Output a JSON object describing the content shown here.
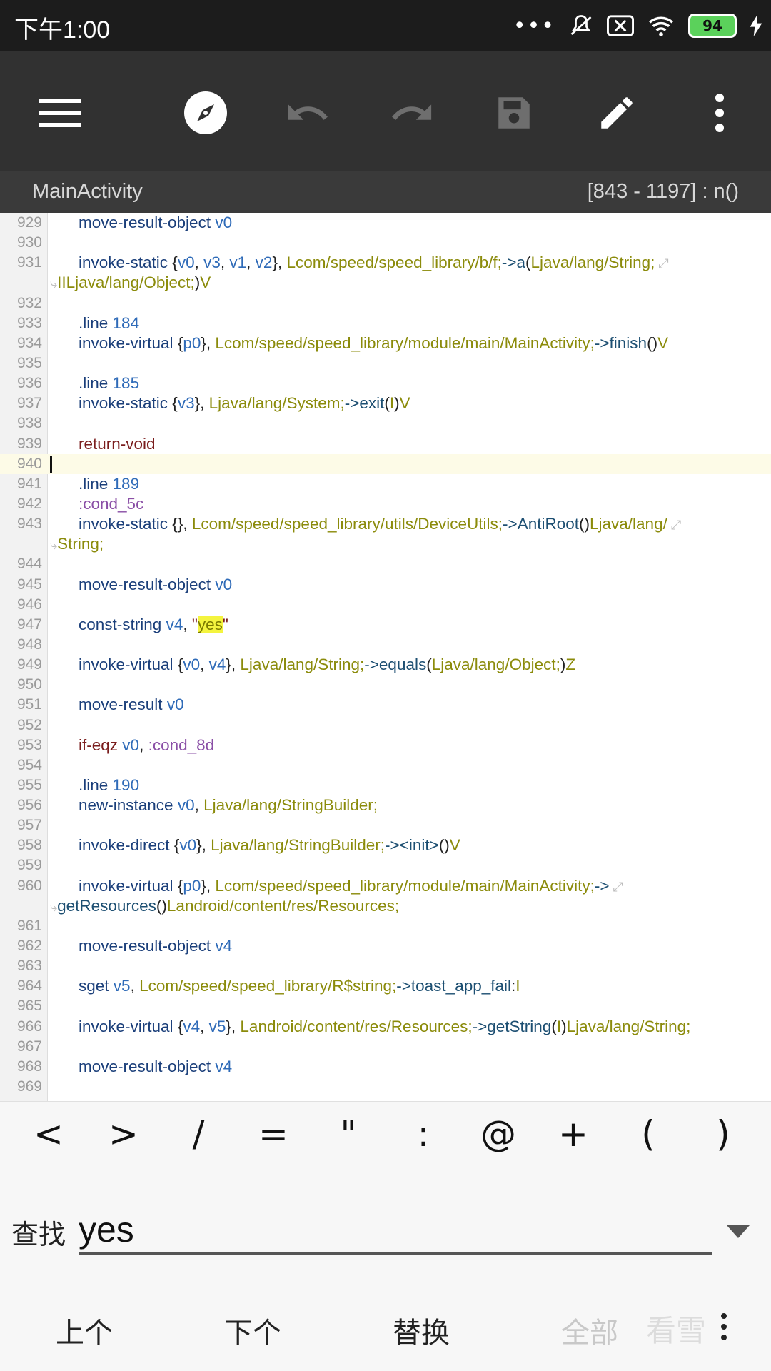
{
  "status": {
    "time": "下午1:00",
    "battery": "94"
  },
  "toolbar": {
    "icons": [
      "menu-icon",
      "compass-icon",
      "undo-icon",
      "redo-icon",
      "save-icon",
      "edit-icon",
      "more-icon"
    ]
  },
  "header": {
    "title": "MainActivity",
    "range": "[843 - 1197] : n()"
  },
  "editor": {
    "current_line": "940",
    "lines": [
      {
        "n": "929",
        "segs": [
          [
            "move-result-object",
            "kw"
          ],
          [
            " ",
            "pun"
          ],
          [
            "v0",
            "reg"
          ]
        ]
      },
      {
        "n": "930",
        "segs": []
      },
      {
        "n": "931",
        "segs": [
          [
            "invoke-static",
            "kw"
          ],
          [
            " {",
            "pun"
          ],
          [
            "v0",
            "reg"
          ],
          [
            ", ",
            "pun"
          ],
          [
            "v3",
            "reg"
          ],
          [
            ", ",
            "pun"
          ],
          [
            "v1",
            "reg"
          ],
          [
            ", ",
            "pun"
          ],
          [
            "v2",
            "reg"
          ],
          [
            "}, ",
            "pun"
          ],
          [
            "Lcom/speed/speed_library/b/f;",
            "ty"
          ],
          [
            "->",
            "cls"
          ],
          [
            "a",
            "cls"
          ],
          [
            "(",
            "pun"
          ],
          [
            "Ljava/lang/String;",
            "ty"
          ]
        ],
        "wrap": true
      },
      {
        "n": "",
        "cont": true,
        "segs": [
          [
            "IILjava/lang/Object;",
            "ty"
          ],
          [
            ")",
            "pun"
          ],
          [
            "V",
            "ty"
          ]
        ]
      },
      {
        "n": "932",
        "segs": []
      },
      {
        "n": "933",
        "segs": [
          [
            ".line",
            "kw"
          ],
          [
            " ",
            "pun"
          ],
          [
            "184",
            "reg"
          ]
        ]
      },
      {
        "n": "934",
        "segs": [
          [
            "invoke-virtual",
            "kw"
          ],
          [
            " {",
            "pun"
          ],
          [
            "p0",
            "reg"
          ],
          [
            "}, ",
            "pun"
          ],
          [
            "Lcom/speed/speed_library/module/main/MainActivity;",
            "ty"
          ],
          [
            "->",
            "cls"
          ],
          [
            "finish",
            "cls"
          ],
          [
            "()",
            "pun"
          ],
          [
            "V",
            "ty"
          ]
        ]
      },
      {
        "n": "935",
        "segs": []
      },
      {
        "n": "936",
        "segs": [
          [
            ".line",
            "kw"
          ],
          [
            " ",
            "pun"
          ],
          [
            "185",
            "reg"
          ]
        ]
      },
      {
        "n": "937",
        "segs": [
          [
            "invoke-static",
            "kw"
          ],
          [
            " {",
            "pun"
          ],
          [
            "v3",
            "reg"
          ],
          [
            "}, ",
            "pun"
          ],
          [
            "Ljava/lang/System;",
            "ty"
          ],
          [
            "->",
            "cls"
          ],
          [
            "exit",
            "cls"
          ],
          [
            "(",
            "pun"
          ],
          [
            "I",
            "ty"
          ],
          [
            ")",
            "pun"
          ],
          [
            "V",
            "ty"
          ]
        ]
      },
      {
        "n": "938",
        "segs": []
      },
      {
        "n": "939",
        "segs": [
          [
            "return-void",
            "red"
          ]
        ]
      },
      {
        "n": "940",
        "segs": [],
        "current": true
      },
      {
        "n": "941",
        "segs": [
          [
            ".line",
            "kw"
          ],
          [
            " ",
            "pun"
          ],
          [
            "189",
            "reg"
          ]
        ]
      },
      {
        "n": "942",
        "segs": [
          [
            ":cond_5c",
            "pur"
          ]
        ]
      },
      {
        "n": "943",
        "segs": [
          [
            "invoke-static",
            "kw"
          ],
          [
            " {}, ",
            "pun"
          ],
          [
            "Lcom/speed/speed_library/utils/DeviceUtils;",
            "ty"
          ],
          [
            "->",
            "cls"
          ],
          [
            "AntiRoot",
            "cls"
          ],
          [
            "()",
            "pun"
          ],
          [
            "Ljava/lang/",
            "ty"
          ]
        ],
        "wrap": true
      },
      {
        "n": "",
        "cont": true,
        "segs": [
          [
            "String;",
            "ty"
          ]
        ]
      },
      {
        "n": "944",
        "segs": []
      },
      {
        "n": "945",
        "segs": [
          [
            "move-result-object",
            "kw"
          ],
          [
            " ",
            "pun"
          ],
          [
            "v0",
            "reg"
          ]
        ]
      },
      {
        "n": "946",
        "segs": []
      },
      {
        "n": "947",
        "segs": [
          [
            "const-string",
            "kw"
          ],
          [
            " ",
            "pun"
          ],
          [
            "v4",
            "reg"
          ],
          [
            ", ",
            "pun"
          ],
          [
            "\"",
            "red"
          ],
          [
            "yes",
            "hl"
          ],
          [
            "\"",
            "red"
          ]
        ]
      },
      {
        "n": "948",
        "segs": []
      },
      {
        "n": "949",
        "segs": [
          [
            "invoke-virtual",
            "kw"
          ],
          [
            " {",
            "pun"
          ],
          [
            "v0",
            "reg"
          ],
          [
            ", ",
            "pun"
          ],
          [
            "v4",
            "reg"
          ],
          [
            "}, ",
            "pun"
          ],
          [
            "Ljava/lang/String;",
            "ty"
          ],
          [
            "->",
            "cls"
          ],
          [
            "equals",
            "cls"
          ],
          [
            "(",
            "pun"
          ],
          [
            "Ljava/lang/Object;",
            "ty"
          ],
          [
            ")",
            "pun"
          ],
          [
            "Z",
            "ty"
          ]
        ]
      },
      {
        "n": "950",
        "segs": []
      },
      {
        "n": "951",
        "segs": [
          [
            "move-result",
            "kw"
          ],
          [
            " ",
            "pun"
          ],
          [
            "v0",
            "reg"
          ]
        ]
      },
      {
        "n": "952",
        "segs": []
      },
      {
        "n": "953",
        "segs": [
          [
            "if-eqz",
            "red"
          ],
          [
            " ",
            "pun"
          ],
          [
            "v0",
            "reg"
          ],
          [
            ", ",
            "pun"
          ],
          [
            ":cond_8d",
            "pur"
          ]
        ]
      },
      {
        "n": "954",
        "segs": []
      },
      {
        "n": "955",
        "segs": [
          [
            ".line",
            "kw"
          ],
          [
            " ",
            "pun"
          ],
          [
            "190",
            "reg"
          ]
        ]
      },
      {
        "n": "956",
        "segs": [
          [
            "new-instance",
            "kw"
          ],
          [
            " ",
            "pun"
          ],
          [
            "v0",
            "reg"
          ],
          [
            ", ",
            "pun"
          ],
          [
            "Ljava/lang/StringBuilder;",
            "ty"
          ]
        ]
      },
      {
        "n": "957",
        "segs": []
      },
      {
        "n": "958",
        "segs": [
          [
            "invoke-direct",
            "kw"
          ],
          [
            " {",
            "pun"
          ],
          [
            "v0",
            "reg"
          ],
          [
            "}, ",
            "pun"
          ],
          [
            "Ljava/lang/StringBuilder;",
            "ty"
          ],
          [
            "->",
            "cls"
          ],
          [
            "<init>",
            "cls"
          ],
          [
            "()",
            "pun"
          ],
          [
            "V",
            "ty"
          ]
        ]
      },
      {
        "n": "959",
        "segs": []
      },
      {
        "n": "960",
        "segs": [
          [
            "invoke-virtual",
            "kw"
          ],
          [
            " {",
            "pun"
          ],
          [
            "p0",
            "reg"
          ],
          [
            "}, ",
            "pun"
          ],
          [
            "Lcom/speed/speed_library/module/main/MainActivity;",
            "ty"
          ],
          [
            "->",
            "cls"
          ]
        ],
        "wrap": true
      },
      {
        "n": "",
        "cont": true,
        "segs": [
          [
            "getResources",
            "cls"
          ],
          [
            "()",
            "pun"
          ],
          [
            "Landroid/content/res/Resources;",
            "ty"
          ]
        ]
      },
      {
        "n": "961",
        "segs": []
      },
      {
        "n": "962",
        "segs": [
          [
            "move-result-object",
            "kw"
          ],
          [
            " ",
            "pun"
          ],
          [
            "v4",
            "reg"
          ]
        ]
      },
      {
        "n": "963",
        "segs": []
      },
      {
        "n": "964",
        "segs": [
          [
            "sget",
            "kw"
          ],
          [
            " ",
            "pun"
          ],
          [
            "v5",
            "reg"
          ],
          [
            ", ",
            "pun"
          ],
          [
            "Lcom/speed/speed_library/R$string;",
            "ty"
          ],
          [
            "->",
            "cls"
          ],
          [
            "toast_app_fail",
            "cls"
          ],
          [
            ":",
            "pun"
          ],
          [
            "I",
            "ty"
          ]
        ]
      },
      {
        "n": "965",
        "segs": []
      },
      {
        "n": "966",
        "segs": [
          [
            "invoke-virtual",
            "kw"
          ],
          [
            " {",
            "pun"
          ],
          [
            "v4",
            "reg"
          ],
          [
            ", ",
            "pun"
          ],
          [
            "v5",
            "reg"
          ],
          [
            "}, ",
            "pun"
          ],
          [
            "Landroid/content/res/Resources;",
            "ty"
          ],
          [
            "->",
            "cls"
          ],
          [
            "getString",
            "cls"
          ],
          [
            "(",
            "pun"
          ],
          [
            "I",
            "ty"
          ],
          [
            ")",
            "pun"
          ],
          [
            "Ljava/lang/String;",
            "ty"
          ]
        ]
      },
      {
        "n": "967",
        "segs": []
      },
      {
        "n": "968",
        "segs": [
          [
            "move-result-object",
            "kw"
          ],
          [
            " ",
            "pun"
          ],
          [
            "v4",
            "reg"
          ]
        ]
      },
      {
        "n": "969",
        "segs": []
      }
    ]
  },
  "symbols": [
    "<",
    ">",
    "/",
    "=",
    "\"",
    ":",
    "@",
    "+",
    "(",
    ")"
  ],
  "find": {
    "label": "查找",
    "value": "yes"
  },
  "actions": {
    "prev": "上个",
    "next": "下个",
    "replace": "替换",
    "all": "全部",
    "more_icon": "more-vertical-icon"
  },
  "watermark": "看雪",
  "colors": {
    "toolbar": "#313131",
    "statusbar": "#1c1c1c",
    "highlight": "#f4f43e",
    "current_line": "#fdfbe7"
  }
}
